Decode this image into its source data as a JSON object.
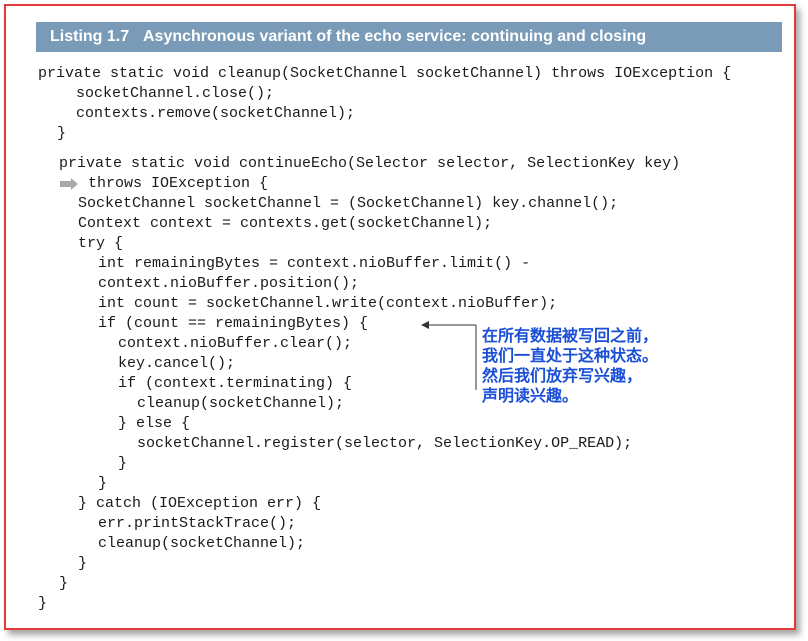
{
  "header": {
    "label": "Listing 1.7",
    "title": "Asynchronous variant of the echo service: continuing and closing"
  },
  "code_lines": [
    "private static void cleanup(SocketChannel socketChannel) throws IOException {",
    "socketChannel.close();",
    "contexts.remove(socketChannel);",
    "}",
    "private static void continueEcho(Selector selector, SelectionKey key)",
    "throws IOException {",
    "SocketChannel socketChannel = (SocketChannel) key.channel();",
    "Context context = contexts.get(socketChannel);",
    "try {",
    "int remainingBytes = context.nioBuffer.limit() -",
    "context.nioBuffer.position();",
    "int count = socketChannel.write(context.nioBuffer);",
    "if (count == remainingBytes) {",
    "context.nioBuffer.clear();",
    "key.cancel();",
    "if (context.terminating) {",
    "cleanup(socketChannel);",
    "} else {",
    "socketChannel.register(selector, SelectionKey.OP_READ);",
    "}",
    "}",
    "} catch (IOException err) {",
    "err.printStackTrace();",
    "cleanup(socketChannel);",
    "}",
    "}",
    "}"
  ],
  "annotation": {
    "lines": [
      "在所有数据被写回之前，",
      "我们一直处于这种状态。",
      "然后我们放弃写兴趣，",
      "声明读兴趣。"
    ],
    "color": "#1a4fd6"
  },
  "colors": {
    "header_bg": "#7a9bb8",
    "border": "#e23a3a"
  }
}
